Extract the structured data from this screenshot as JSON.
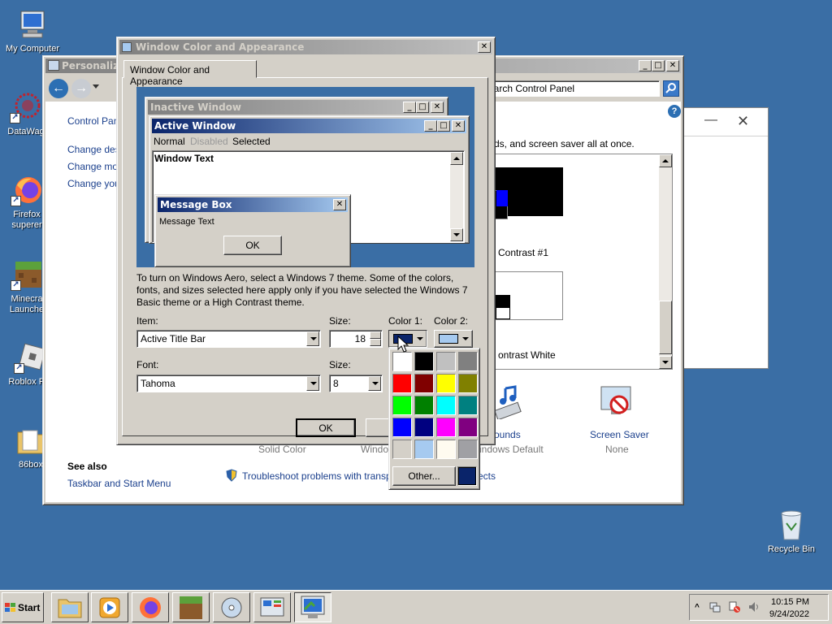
{
  "desktop": {
    "icons": [
      {
        "label": "My Computer"
      },
      {
        "label": "DataWag"
      },
      {
        "label": "Firefox\nsuperer"
      },
      {
        "label": "Minecra\nLaunche"
      },
      {
        "label": "Roblox Pla"
      },
      {
        "label": "86box"
      },
      {
        "label": "Recycle Bin"
      }
    ]
  },
  "personalization": {
    "title": "Personalizat",
    "search_placeholder": "earch Control Panel",
    "sidebar": {
      "home": "Control Pane",
      "links": [
        "Change desk",
        "Change mou",
        "Change your"
      ],
      "see_also_header": "See also",
      "see_also_links": [
        "Taskbar and Start Menu"
      ]
    },
    "intro": "ds, and screen saver all at once.",
    "themes": [
      {
        "label": "Contrast #1"
      },
      {
        "label": "ontrast White"
      }
    ],
    "bottom_items": [
      {
        "title": "",
        "sub": "Solid Color"
      },
      {
        "title": "",
        "sub": "Windo"
      },
      {
        "title": "ounds",
        "sub": "indows Default"
      },
      {
        "title": "Screen Saver",
        "sub": "None"
      }
    ],
    "troubleshoot": "Troubleshoot problems with transpare",
    "troubleshoot_tail": "ects"
  },
  "dialog": {
    "title": "Window Color and Appearance",
    "tab": "Window Color and Appearance",
    "preview": {
      "inactive_title": "Inactive Window",
      "active_title": "Active Window",
      "menu": [
        "Normal",
        "Disabled",
        "Selected"
      ],
      "window_text": "Window Text",
      "msgbox_title": "Message Box",
      "msgbox_text": "Message Text",
      "ok": "OK"
    },
    "description": "To turn on Windows Aero, select a Windows 7 theme.  Some of the colors, fonts, and sizes selected here apply only if you have selected the Windows 7 Basic theme or a High Contrast theme.",
    "item_label": "Item:",
    "item_value": "Active Title Bar",
    "size_label": "Size:",
    "size_value": "18",
    "color1_label": "Color 1:",
    "color2_label": "Color 2:",
    "font_label": "Font:",
    "font_value": "Tahoma",
    "font_size_label": "Size:",
    "font_size_value": "8",
    "ok": "OK",
    "cancel": "Ca",
    "colors": {
      "color1": "#0a246a",
      "color2": "#a6caf0"
    }
  },
  "palette": {
    "colors": [
      "#ffffff",
      "#000000",
      "#c0c0c0",
      "#808080",
      "#ff0000",
      "#800000",
      "#ffff00",
      "#808000",
      "#00ff00",
      "#008000",
      "#00ffff",
      "#008080",
      "#0000ff",
      "#000080",
      "#ff00ff",
      "#800080",
      "#d4d0c8",
      "#a6caf0",
      "#fffbf0",
      "#a0a0a4"
    ],
    "other_label": "Other...",
    "current": "#0a246a"
  },
  "taskbar": {
    "start": "Start",
    "clock_time": "10:15 PM",
    "clock_date": "9/24/2022"
  }
}
